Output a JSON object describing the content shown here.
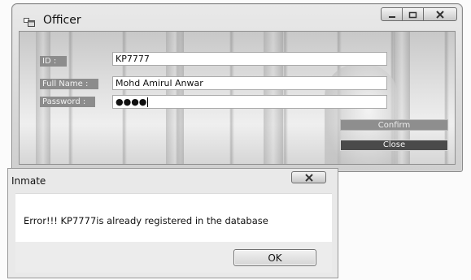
{
  "officer_window": {
    "title": "Officer",
    "form": {
      "id_label": "ID :",
      "id_value": "KP7777",
      "fullname_label": "Full Name :",
      "fullname_value": "Mohd Amirul Anwar",
      "password_label": "Password :",
      "password_value": "●●●●"
    },
    "buttons": {
      "confirm": "Confirm",
      "close": "Close"
    }
  },
  "inmate_dialog": {
    "title": "Inmate",
    "message": "Error!!! KP7777is already registered in the database",
    "ok": "OK"
  },
  "colors": {
    "label_bg": "#8c8c8c",
    "close_button_bg": "#4a4a4a",
    "confirm_button_bg": "#8e8e8e"
  },
  "icons": [
    "app-window-icon",
    "minimize-icon",
    "maximize-icon",
    "close-icon"
  ]
}
